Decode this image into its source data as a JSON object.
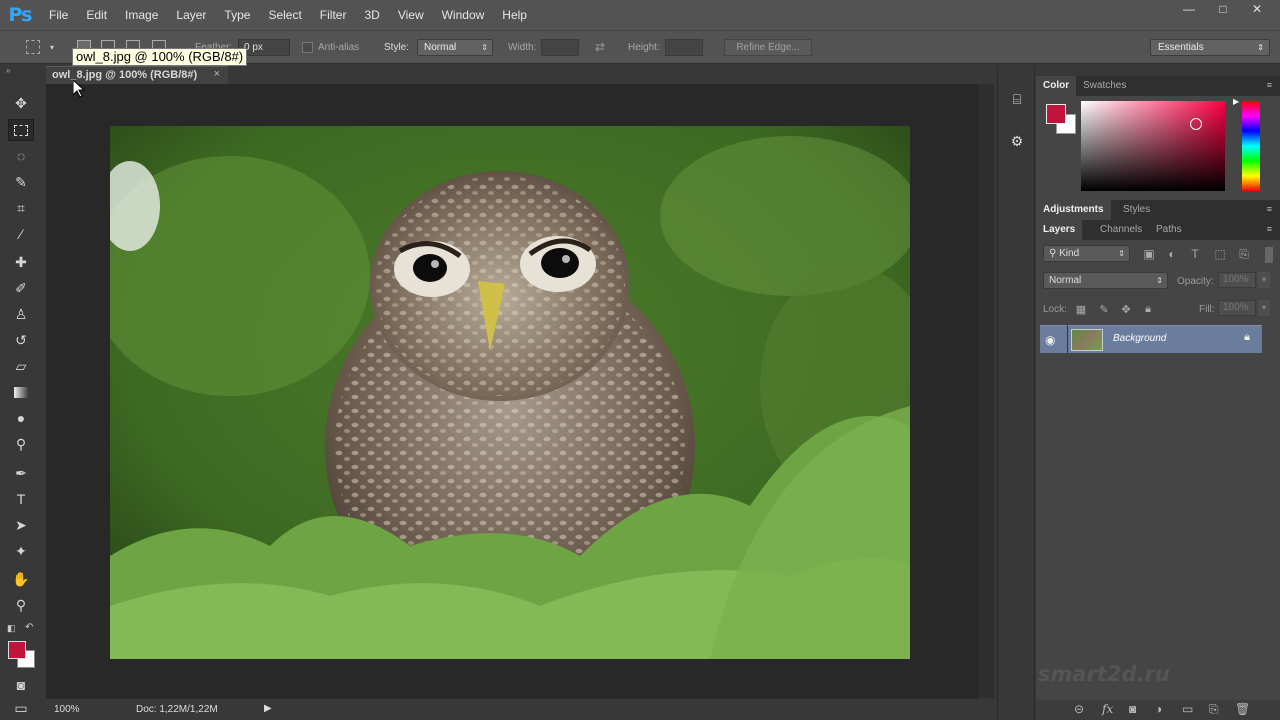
{
  "app": {
    "logo": "Ps",
    "menu": [
      "File",
      "Edit",
      "Image",
      "Layer",
      "Type",
      "Select",
      "Filter",
      "3D",
      "View",
      "Window",
      "Help"
    ],
    "window_controls": [
      "—",
      "□",
      "✕"
    ]
  },
  "options_bar": {
    "feather_label": "Feather:",
    "feather_value": "0 px",
    "antialias_label": "Anti-alias",
    "style_label": "Style:",
    "style_value": "Normal",
    "width_label": "Width:",
    "height_label": "Height:",
    "refine_edge_label": "Refine Edge...",
    "workspace_value": "Essentials"
  },
  "document": {
    "tab_label": "owl_8.jpg @ 100% (RGB/8#)",
    "tab_close": "×",
    "tooltip": "owl_8.jpg @ 100% (RGB/8#)"
  },
  "status": {
    "zoom": "100%",
    "doc_info": "Doc: 1,22M/1,22M",
    "arrow": "▶"
  },
  "color_panel": {
    "tabs": [
      "Color",
      "Swatches"
    ],
    "foreground": "#c0143c",
    "background": "#ffffff"
  },
  "adjustments_panel": {
    "tabs": [
      "Adjustments",
      "Styles"
    ]
  },
  "layers_panel": {
    "tabs": [
      "Layers",
      "Channels",
      "Paths"
    ],
    "filter_kind": "Kind",
    "blend_mode": "Normal",
    "opacity_label": "Opacity:",
    "opacity_value": "100%",
    "lock_label": "Lock:",
    "fill_label": "Fill:",
    "fill_value": "100%",
    "layers": [
      {
        "name": "Background",
        "visible": true,
        "locked": true
      }
    ]
  },
  "watermark": "smart2d.ru",
  "colors": {
    "accent_logo": "#31a8ff",
    "selected_layer": "#6a7d9c"
  }
}
